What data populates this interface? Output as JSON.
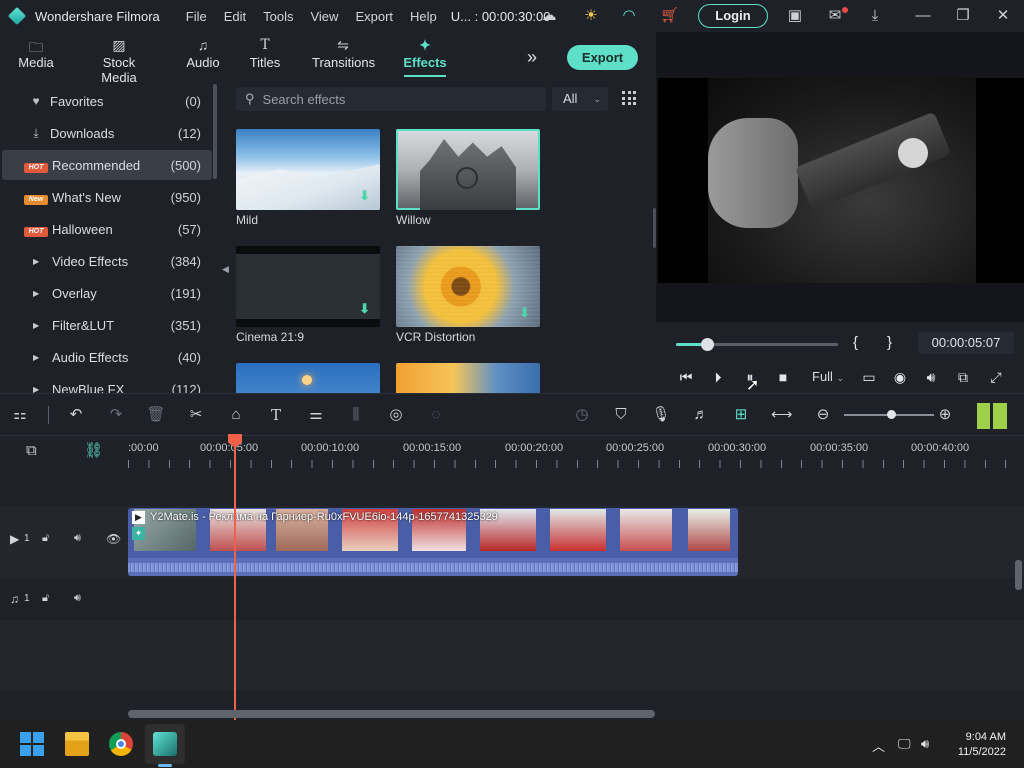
{
  "window": {
    "app_name": "Wondershare Filmora",
    "menu": [
      "File",
      "Edit",
      "Tools",
      "View",
      "Export",
      "Help"
    ],
    "project_label": "U... : 00:00:30:00",
    "login_label": "Login"
  },
  "nav": {
    "tabs": [
      {
        "label": "Media",
        "icon": "folder-icon"
      },
      {
        "label": "Stock Media",
        "icon": "image-icon"
      },
      {
        "label": "Audio",
        "icon": "music-note-icon"
      },
      {
        "label": "Titles",
        "icon": "text-t-icon"
      },
      {
        "label": "Transitions",
        "icon": "transition-icon"
      },
      {
        "label": "Effects",
        "icon": "effects-icon",
        "active": true
      }
    ],
    "more_icon": "double-chevron-right-icon",
    "export_label": "Export"
  },
  "categories": [
    {
      "label": "Favorites",
      "count": "(0)",
      "icon": "heart-icon"
    },
    {
      "label": "Downloads",
      "count": "(12)",
      "icon": "download-icon"
    },
    {
      "label": "Recommended",
      "count": "(500)",
      "badge": "HOT",
      "selected": true
    },
    {
      "label": "What's New",
      "count": "(950)",
      "badge": "New"
    },
    {
      "label": "Halloween",
      "count": "(57)",
      "badge": "HOT"
    },
    {
      "label": "Video Effects",
      "count": "(384)",
      "expandable": true
    },
    {
      "label": "Overlay",
      "count": "(191)",
      "expandable": true
    },
    {
      "label": "Filter&LUT",
      "count": "(351)",
      "expandable": true
    },
    {
      "label": "Audio Effects",
      "count": "(40)",
      "expandable": true
    },
    {
      "label": "NewBlue FX",
      "count": "(112)",
      "expandable": true
    }
  ],
  "search": {
    "placeholder": "Search effects",
    "filter_value": "All"
  },
  "effects": [
    {
      "name": "Mild",
      "download": true
    },
    {
      "name": "Willow",
      "selected": true
    },
    {
      "name": "Cinema 21:9",
      "download": true
    },
    {
      "name": "VCR Distortion",
      "download": true
    },
    {
      "name": ""
    },
    {
      "name": ""
    }
  ],
  "preview": {
    "timecode": "00:00:05:07",
    "progress_fraction": 0.19,
    "quality": "Full",
    "mark_in": "{",
    "mark_out": "}"
  },
  "timeline": {
    "ruler_labels": [
      ":00:00",
      "00:00:05:00",
      "00:00:10:00",
      "00:00:15:00",
      "00:00:20:00",
      "00:00:25:00",
      "00:00:30:00",
      "00:00:35:00",
      "00:00:40:00"
    ],
    "video_track_label": "1",
    "audio_track_label": "1",
    "clip_title": "Y2Mate.is - Реклама на Гарниер-Ru0xFVUE6io-144p-1657741325329"
  },
  "taskbar": {
    "time": "9:04 AM",
    "date": "11/5/2022"
  },
  "colors": {
    "accent": "#5de0c7",
    "playhead": "#f0604a",
    "clip": "#4a5ea8"
  }
}
